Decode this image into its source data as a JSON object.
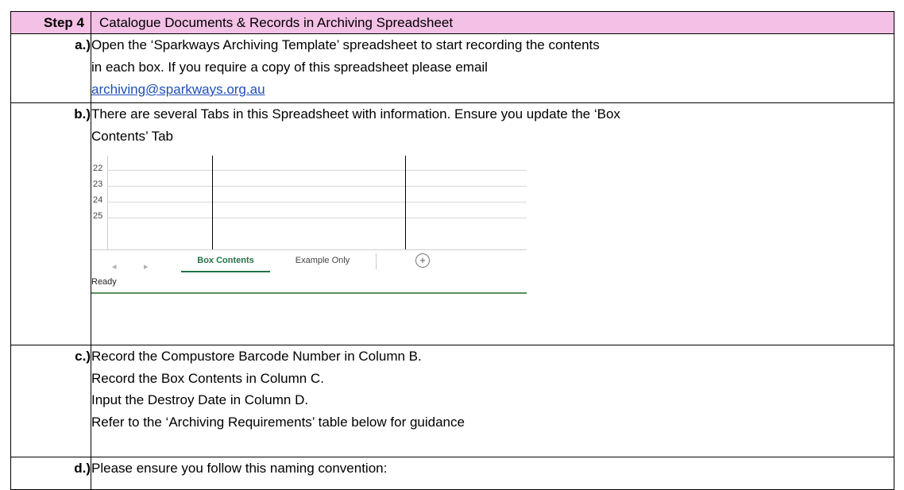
{
  "header": {
    "step": "Step 4",
    "title": "Catalogue Documents & Records in Archiving Spreadsheet"
  },
  "steps": {
    "a": {
      "label": "a.)",
      "line1": "Open the ‘Sparkways Archiving Template’ spreadsheet to start recording the contents",
      "line2": "in each box. If you require a copy of this spreadsheet please email",
      "email": "archiving@sparkways.org.au"
    },
    "b": {
      "label": "b.)",
      "line1": "There are several Tabs in this Spreadsheet with information. Ensure you update the ‘Box",
      "line2": "Contents’ Tab"
    },
    "c": {
      "label": "c.)",
      "lines": [
        "Record the Compustore Barcode Number in Column B.",
        "Record the Box Contents in Column C.",
        "Input the Destroy Date in Column D.",
        "Refer to the ‘Archiving Requirements’ table below for guidance"
      ]
    },
    "d": {
      "label": "d.)",
      "line1": "Please ensure you follow this naming convention:"
    }
  },
  "spreadsheet": {
    "row_numbers": [
      "22",
      "23",
      "24",
      "25"
    ],
    "nav_prev": "◂",
    "nav_next": "▸",
    "tab_active": "Box Contents",
    "tab_other": "Example Only",
    "add_tab": "+",
    "status": "Ready"
  }
}
